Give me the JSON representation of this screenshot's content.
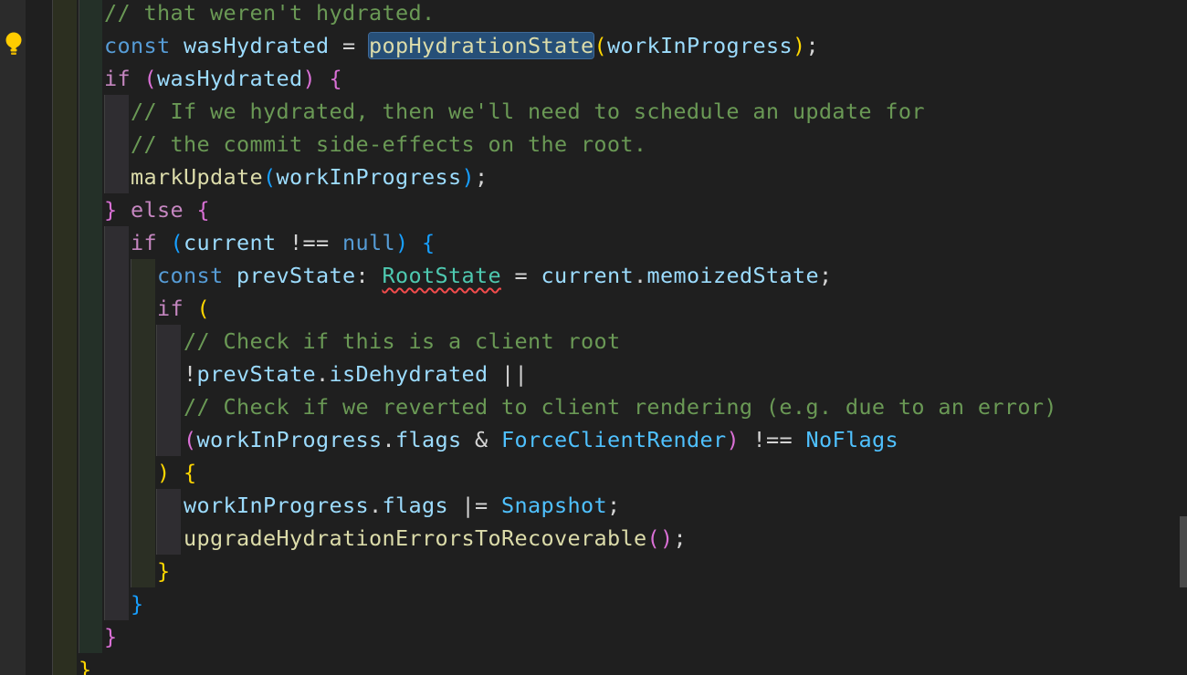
{
  "editor": {
    "gutter": {
      "lightbulb_icon": "lightbulb-icon"
    },
    "lines": [
      {
        "id": "l0",
        "tokens": [
          {
            "text": "// that weren't hydrated.",
            "kind": "comment"
          }
        ]
      },
      {
        "id": "l1",
        "tokens": [
          {
            "text": "const",
            "kind": "keyword"
          },
          {
            "text": " ",
            "kind": "punct"
          },
          {
            "text": "wasHydrated",
            "kind": "var"
          },
          {
            "text": " = ",
            "kind": "op"
          },
          {
            "text": "popHydrationState",
            "kind": "func-highlight"
          },
          {
            "text": "(",
            "kind": "br-gold"
          },
          {
            "text": "workInProgress",
            "kind": "var"
          },
          {
            "text": ")",
            "kind": "br-gold"
          },
          {
            "text": ";",
            "kind": "punct"
          }
        ]
      },
      {
        "id": "l2",
        "tokens": [
          {
            "text": "if",
            "kind": "control"
          },
          {
            "text": " ",
            "kind": "punct"
          },
          {
            "text": "(",
            "kind": "br-pink"
          },
          {
            "text": "wasHydrated",
            "kind": "var"
          },
          {
            "text": ")",
            "kind": "br-pink"
          },
          {
            "text": " ",
            "kind": "punct"
          },
          {
            "text": "{",
            "kind": "br-pink"
          }
        ]
      },
      {
        "id": "l3",
        "tokens": [
          {
            "text": "// If we hydrated, then we'll need to schedule an update for",
            "kind": "comment"
          }
        ]
      },
      {
        "id": "l4",
        "tokens": [
          {
            "text": "// the commit side-effects on the root.",
            "kind": "comment"
          }
        ]
      },
      {
        "id": "l5",
        "tokens": [
          {
            "text": "markUpdate",
            "kind": "func"
          },
          {
            "text": "(",
            "kind": "br-blue"
          },
          {
            "text": "workInProgress",
            "kind": "var"
          },
          {
            "text": ")",
            "kind": "br-blue"
          },
          {
            "text": ";",
            "kind": "punct"
          }
        ]
      },
      {
        "id": "l6",
        "tokens": [
          {
            "text": "}",
            "kind": "br-pink"
          },
          {
            "text": " ",
            "kind": "punct"
          },
          {
            "text": "else",
            "kind": "control"
          },
          {
            "text": " ",
            "kind": "punct"
          },
          {
            "text": "{",
            "kind": "br-pink"
          }
        ]
      },
      {
        "id": "l7",
        "tokens": [
          {
            "text": "if",
            "kind": "control"
          },
          {
            "text": " ",
            "kind": "punct"
          },
          {
            "text": "(",
            "kind": "br-blue"
          },
          {
            "text": "current",
            "kind": "var"
          },
          {
            "text": " !== ",
            "kind": "op"
          },
          {
            "text": "null",
            "kind": "keyword"
          },
          {
            "text": ")",
            "kind": "br-blue"
          },
          {
            "text": " ",
            "kind": "punct"
          },
          {
            "text": "{",
            "kind": "br-blue"
          }
        ]
      },
      {
        "id": "l8",
        "tokens": [
          {
            "text": "const",
            "kind": "keyword"
          },
          {
            "text": " ",
            "kind": "punct"
          },
          {
            "text": "prevState",
            "kind": "var"
          },
          {
            "text": ": ",
            "kind": "punct"
          },
          {
            "text": "RootState",
            "kind": "type-squiggle"
          },
          {
            "text": " = ",
            "kind": "op"
          },
          {
            "text": "current",
            "kind": "var"
          },
          {
            "text": ".",
            "kind": "punct"
          },
          {
            "text": "memoizedState",
            "kind": "var"
          },
          {
            "text": ";",
            "kind": "punct"
          }
        ]
      },
      {
        "id": "l9",
        "tokens": [
          {
            "text": "if",
            "kind": "control"
          },
          {
            "text": " ",
            "kind": "punct"
          },
          {
            "text": "(",
            "kind": "br-gold"
          }
        ]
      },
      {
        "id": "l10",
        "tokens": [
          {
            "text": "// Check if this is a client root",
            "kind": "comment"
          }
        ]
      },
      {
        "id": "l11",
        "tokens": [
          {
            "text": "!",
            "kind": "op"
          },
          {
            "text": "prevState",
            "kind": "var"
          },
          {
            "text": ".",
            "kind": "punct"
          },
          {
            "text": "isDehydrated",
            "kind": "var"
          },
          {
            "text": " ||",
            "kind": "op"
          }
        ]
      },
      {
        "id": "l12",
        "tokens": [
          {
            "text": "// Check if we reverted to client rendering (e.g. due to an error)",
            "kind": "comment"
          }
        ]
      },
      {
        "id": "l13",
        "tokens": [
          {
            "text": "(",
            "kind": "br-pink"
          },
          {
            "text": "workInProgress",
            "kind": "var"
          },
          {
            "text": ".",
            "kind": "punct"
          },
          {
            "text": "flags",
            "kind": "var"
          },
          {
            "text": " & ",
            "kind": "op"
          },
          {
            "text": "ForceClientRender",
            "kind": "const"
          },
          {
            "text": ")",
            "kind": "br-pink"
          },
          {
            "text": " !== ",
            "kind": "op"
          },
          {
            "text": "NoFlags",
            "kind": "const"
          }
        ]
      },
      {
        "id": "l14",
        "tokens": [
          {
            "text": ")",
            "kind": "br-gold"
          },
          {
            "text": " ",
            "kind": "punct"
          },
          {
            "text": "{",
            "kind": "br-gold"
          }
        ]
      },
      {
        "id": "l15",
        "tokens": [
          {
            "text": "workInProgress",
            "kind": "var"
          },
          {
            "text": ".",
            "kind": "punct"
          },
          {
            "text": "flags",
            "kind": "var"
          },
          {
            "text": " |= ",
            "kind": "op"
          },
          {
            "text": "Snapshot",
            "kind": "const"
          },
          {
            "text": ";",
            "kind": "punct"
          }
        ]
      },
      {
        "id": "l16",
        "tokens": [
          {
            "text": "upgradeHydrationErrorsToRecoverable",
            "kind": "func"
          },
          {
            "text": "(",
            "kind": "br-pink"
          },
          {
            "text": ")",
            "kind": "br-pink"
          },
          {
            "text": ";",
            "kind": "punct"
          }
        ]
      },
      {
        "id": "l17",
        "tokens": [
          {
            "text": "}",
            "kind": "br-gold"
          }
        ]
      },
      {
        "id": "l18",
        "tokens": [
          {
            "text": "}",
            "kind": "br-blue"
          }
        ]
      },
      {
        "id": "l19",
        "tokens": [
          {
            "text": "}",
            "kind": "br-pink"
          }
        ]
      },
      {
        "id": "l20",
        "tokens": [
          {
            "text": "}",
            "kind": "br-gold"
          }
        ]
      }
    ]
  }
}
